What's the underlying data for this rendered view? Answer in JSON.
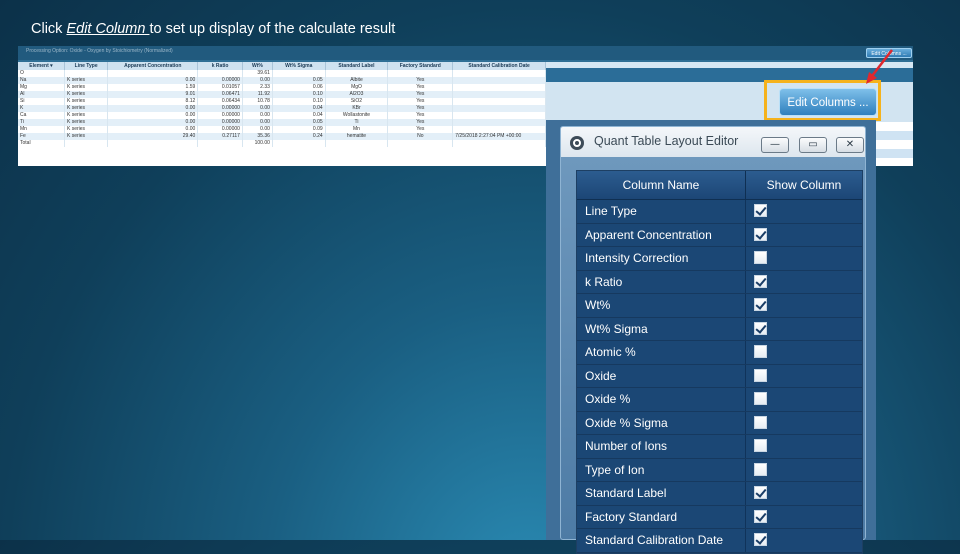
{
  "caption": {
    "before": "Click ",
    "link": "Edit Column ",
    "after": "to set up display of the calculate result"
  },
  "quant_table": {
    "top_hint": "Processing Option: Oxide - Oxygen by Stoichiometry (Normalized)",
    "edit_button": "Edit Columns ...",
    "headers": [
      "Element ▾",
      "Line Type",
      "Apparent Concentration",
      "k Ratio",
      "Wt%",
      "Wt% Sigma",
      "Standard Label",
      "Factory Standard",
      "Standard Calibration Date"
    ],
    "rows": [
      [
        "O",
        "",
        "",
        "",
        "39.61",
        "",
        "",
        "",
        ""
      ],
      [
        "Na",
        "K series",
        "0.00",
        "0.00000",
        "0.00",
        "0.05",
        "Albite",
        "Yes",
        ""
      ],
      [
        "Mg",
        "K series",
        "1.59",
        "0.01057",
        "2.33",
        "0.06",
        "MgO",
        "Yes",
        ""
      ],
      [
        "Al",
        "K series",
        "9.01",
        "0.06471",
        "11.92",
        "0.10",
        "Al2O3",
        "Yes",
        ""
      ],
      [
        "Si",
        "K series",
        "8.12",
        "0.06434",
        "10.78",
        "0.10",
        "SiO2",
        "Yes",
        ""
      ],
      [
        "K",
        "K series",
        "0.00",
        "0.00000",
        "0.00",
        "0.04",
        "KBr",
        "Yes",
        ""
      ],
      [
        "Ca",
        "K series",
        "0.00",
        "0.00000",
        "0.00",
        "0.04",
        "Wollastonite",
        "Yes",
        ""
      ],
      [
        "Ti",
        "K series",
        "0.00",
        "0.00000",
        "0.00",
        "0.05",
        "Ti",
        "Yes",
        ""
      ],
      [
        "Mn",
        "K series",
        "0.00",
        "0.00000",
        "0.00",
        "0.09",
        "Mn",
        "Yes",
        ""
      ],
      [
        "Fe",
        "K series",
        "29.40",
        "0.27117",
        "35.36",
        "0.24",
        "hematite",
        "No",
        "7/25/2018 2:27:04 PM +00:00"
      ],
      [
        "Total",
        "",
        "",
        "",
        "100.00",
        "",
        "",
        "",
        ""
      ]
    ]
  },
  "zoom_button": "Edit Columns ...",
  "dialog": {
    "title": "Quant Table Layout Editor",
    "minimize": "—",
    "maximize": "▭",
    "close": "✕",
    "col_name_header": "Column Name",
    "show_col_header": "Show Column",
    "columns": [
      {
        "name": "Line Type",
        "checked": true
      },
      {
        "name": "Apparent Concentration",
        "checked": true
      },
      {
        "name": "Intensity Correction",
        "checked": false
      },
      {
        "name": "k Ratio",
        "checked": true
      },
      {
        "name": "Wt%",
        "checked": true
      },
      {
        "name": "Wt% Sigma",
        "checked": true
      },
      {
        "name": "Atomic %",
        "checked": false
      },
      {
        "name": "Oxide",
        "checked": false
      },
      {
        "name": "Oxide %",
        "checked": false
      },
      {
        "name": "Oxide % Sigma",
        "checked": false
      },
      {
        "name": "Number of Ions",
        "checked": false
      },
      {
        "name": "Type of Ion",
        "checked": false
      },
      {
        "name": "Standard Label",
        "checked": true
      },
      {
        "name": "Factory Standard",
        "checked": true
      },
      {
        "name": "Standard Calibration Date",
        "checked": true
      }
    ]
  },
  "colors": {
    "highlight": "#f5b21c",
    "arrow": "#e0282e"
  }
}
